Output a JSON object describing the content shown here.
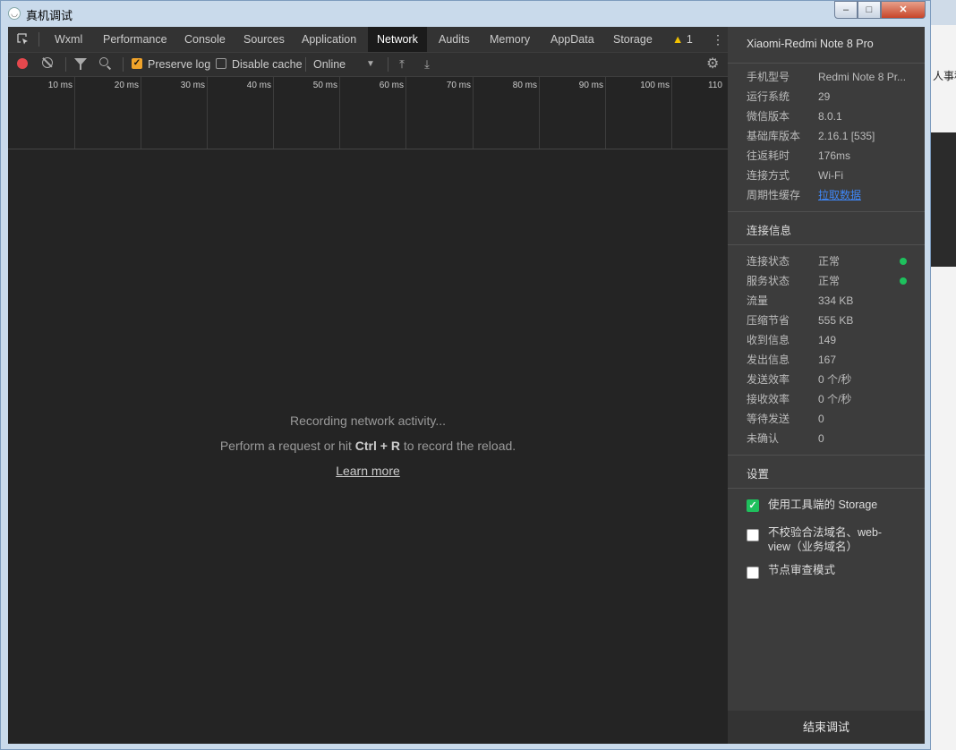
{
  "window": {
    "title": "真机调试",
    "controls": {
      "minimize": "–",
      "maximize": "□",
      "close": "✕"
    }
  },
  "background": {
    "right_text": "人事科"
  },
  "tabs": [
    {
      "label": "Wxml"
    },
    {
      "label": "Performance"
    },
    {
      "label": "Console"
    },
    {
      "label": "Sources"
    },
    {
      "label": "Application"
    },
    {
      "label": "Network",
      "active": true
    },
    {
      "label": "Audits"
    },
    {
      "label": "Memory"
    },
    {
      "label": "AppData"
    },
    {
      "label": "Storage"
    }
  ],
  "warnings": {
    "count": "1",
    "icon": "warning-icon"
  },
  "toolbar": {
    "preserve_log": "Preserve log",
    "preserve_log_checked": true,
    "disable_cache": "Disable cache",
    "disable_cache_checked": false,
    "throttling": "Online"
  },
  "timeline": {
    "ticks": [
      "10 ms",
      "20 ms",
      "30 ms",
      "40 ms",
      "50 ms",
      "60 ms",
      "70 ms",
      "80 ms",
      "90 ms",
      "100 ms",
      "110"
    ]
  },
  "empty_state": {
    "line1": "Recording network activity...",
    "line2_prefix": "Perform a request or hit ",
    "shortcut": "Ctrl + R",
    "line2_suffix": " to record the reload.",
    "link": "Learn more"
  },
  "panel": {
    "device": "Xiaomi-Redmi Note 8 Pro",
    "info": [
      {
        "key": "手机型号",
        "value": "Redmi Note 8 Pr..."
      },
      {
        "key": "运行系统",
        "value": "29"
      },
      {
        "key": "微信版本",
        "value": "8.0.1"
      },
      {
        "key": "基础库版本",
        "value": "2.16.1 [535]"
      },
      {
        "key": "往返耗时",
        "value": "176ms"
      },
      {
        "key": "连接方式",
        "value": "Wi-Fi"
      },
      {
        "key": "周期性缓存",
        "value": "拉取数据"
      }
    ],
    "connection_title": "连接信息",
    "connection": [
      {
        "key": "连接状态",
        "value": "正常",
        "status_color": "#1ec15d"
      },
      {
        "key": "服务状态",
        "value": "正常",
        "status_color": "#1ec15d"
      },
      {
        "key": "流量",
        "value": "334 KB"
      },
      {
        "key": "压缩节省",
        "value": "555 KB"
      },
      {
        "key": "收到信息",
        "value": "149"
      },
      {
        "key": "发出信息",
        "value": "167"
      },
      {
        "key": "发送效率",
        "value": "0 个/秒"
      },
      {
        "key": "接收效率",
        "value": "0 个/秒"
      },
      {
        "key": "等待发送",
        "value": "0"
      },
      {
        "key": "未确认",
        "value": "0"
      }
    ],
    "settings_title": "设置",
    "settings": [
      {
        "label": "使用工具端的 Storage",
        "checked": true
      },
      {
        "label": "不校验合法域名、web-view（业务域名）",
        "checked": false
      },
      {
        "label": "节点审查模式",
        "checked": false
      }
    ],
    "end_button": "结束调试"
  }
}
